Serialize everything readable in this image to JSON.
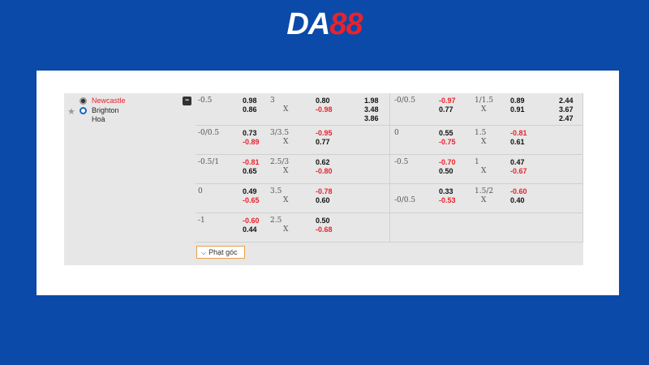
{
  "brand": {
    "logo_da": "DA",
    "logo_num": "88"
  },
  "match": {
    "home": "Newcastle",
    "away": "Brighton",
    "draw": "Hoà"
  },
  "rows": [
    {
      "left": {
        "hcap": "-0.5",
        "h1": "0.98",
        "h2": "0.86",
        "ou": "3",
        "oux": "X",
        "o1": "0.80",
        "o2": "-0.98",
        "x1": "1.98",
        "x2": "3.48",
        "x3": "3.86"
      },
      "right": {
        "hcap": "-0/0.5",
        "h1": "-0.97",
        "h2": "0.77",
        "ou": "1/1.5",
        "oux": "X",
        "o1": "0.89",
        "o2": "0.91",
        "x1": "2.44",
        "x2": "3.67",
        "x3": "2.47"
      }
    },
    {
      "left": {
        "hcap": "-0/0.5",
        "h1": "0.73",
        "h2": "-0.89",
        "ou": "3/3.5",
        "oux": "X",
        "o1": "-0.95",
        "o2": "0.77"
      },
      "right": {
        "hcap": "0",
        "h1": "0.55",
        "h2": "-0.75",
        "ou": "1.5",
        "oux": "X",
        "o1": "-0.81",
        "o2": "0.61"
      }
    },
    {
      "left": {
        "hcap": "-0.5/1",
        "h1": "-0.81",
        "h2": "0.65",
        "ou": "2.5/3",
        "oux": "X",
        "o1": "0.62",
        "o2": "-0.80"
      },
      "right": {
        "hcap": "-0.5",
        "h1": "-0.70",
        "h2": "0.50",
        "ou": "1",
        "oux": "X",
        "o1": "0.47",
        "o2": "-0.67"
      }
    },
    {
      "left": {
        "hcap": "0",
        "h1": "0.49",
        "h2": "-0.65",
        "ou": "3.5",
        "oux": "X",
        "o1": "-0.78",
        "o2": "0.60"
      },
      "right": {
        "hcap": "-0/0.5",
        "h1": "0.33",
        "h2": "-0.53",
        "ou": "1.5/2",
        "oux": "X",
        "o1": "-0.60",
        "o2": "0.40"
      }
    },
    {
      "left": {
        "hcap": "-1",
        "h1": "-0.60",
        "h2": "0.44",
        "ou": "2.5",
        "oux": "X",
        "o1": "0.50",
        "o2": "-0.68"
      },
      "right": {}
    }
  ],
  "expand_button": {
    "label": "Phạt góc"
  },
  "colors": {
    "background": "#0b4aa8",
    "negative": "#e8232c",
    "board": "#e7e7e7"
  }
}
